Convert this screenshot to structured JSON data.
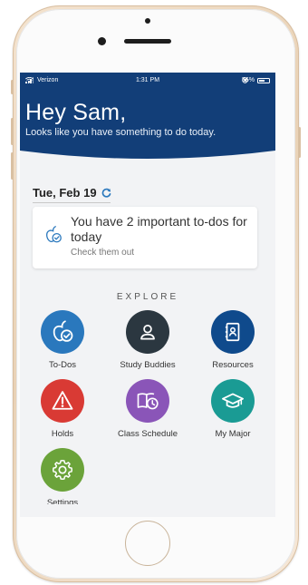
{
  "status_bar": {
    "carrier": "Verizon",
    "time": "1:31 PM",
    "battery": "56%",
    "battery_level": 0.56
  },
  "header": {
    "greeting": "Hey Sam,",
    "subtitle": "Looks like you have something to do today.",
    "color": "#123e78"
  },
  "date": {
    "label": "Tue, Feb 19"
  },
  "todo_card": {
    "title": "You have 2 important to-dos for today",
    "subtitle": "Check them out",
    "icon": "apple-check-icon"
  },
  "explore": {
    "title": "EXPLORE",
    "items": [
      {
        "label": "To-Dos",
        "icon": "apple-check-icon",
        "color": "#2a78bd"
      },
      {
        "label": "Study Buddies",
        "icon": "person-icon",
        "color": "#2b3740"
      },
      {
        "label": "Resources",
        "icon": "contacts-book-icon",
        "color": "#0f4a8c"
      },
      {
        "label": "Holds",
        "icon": "warning-icon",
        "color": "#d93a34"
      },
      {
        "label": "Class Schedule",
        "icon": "book-clock-icon",
        "color": "#8a55b8"
      },
      {
        "label": "My Major",
        "icon": "graduation-cap-icon",
        "color": "#1a9b94"
      },
      {
        "label": "Settings",
        "icon": "gear-icon",
        "color": "#6ba33a"
      }
    ]
  }
}
